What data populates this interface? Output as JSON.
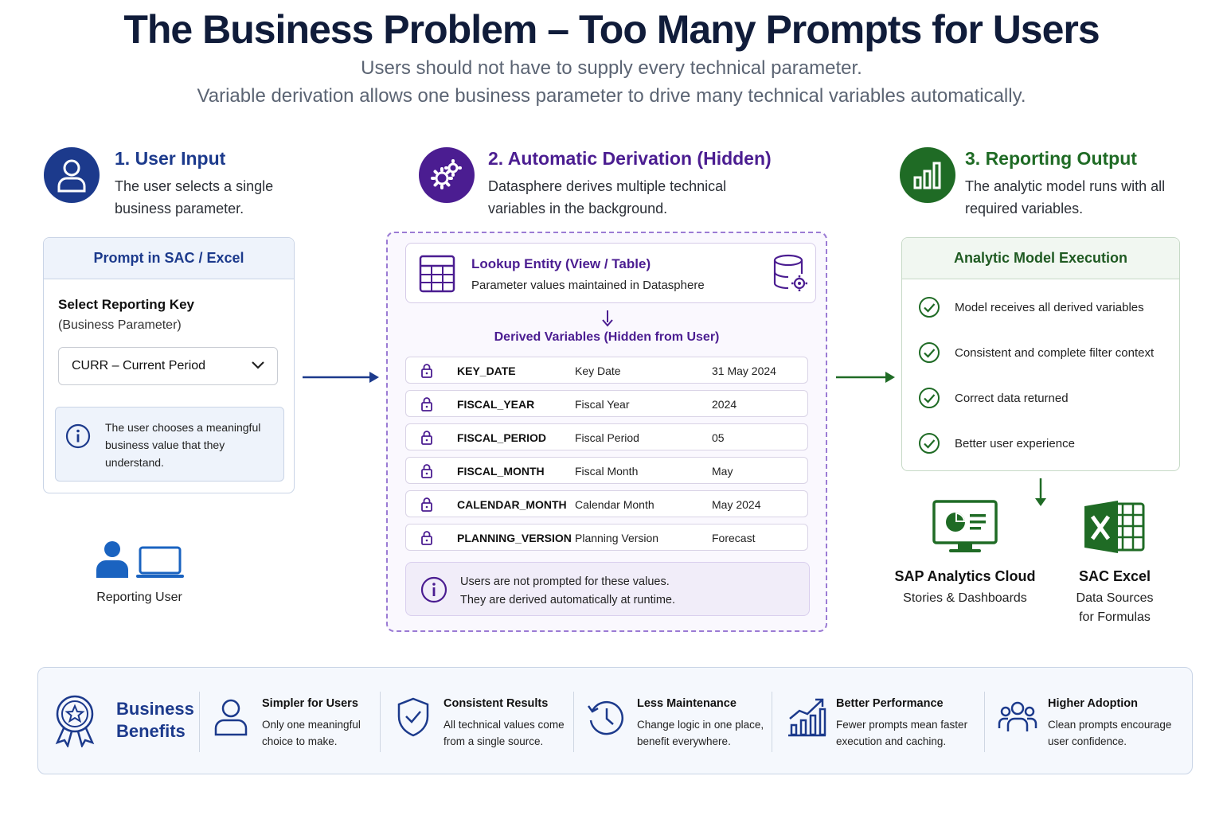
{
  "header": {
    "title": "The Business Problem – Too Many Prompts for Users",
    "subtitle_line1": "Users should not have to supply every technical parameter.",
    "subtitle_line2": "Variable derivation allows one business parameter to drive many technical variables automatically."
  },
  "colors": {
    "blue": "#1c3a8c",
    "purple": "#4b1d91",
    "green": "#1f6b25"
  },
  "steps": [
    {
      "title": "1. User Input",
      "desc_line1": "The user selects a single",
      "desc_line2": "business parameter.",
      "icon": "user-icon"
    },
    {
      "title": "2. Automatic Derivation (Hidden)",
      "desc_line1": "Datasphere derives multiple technical",
      "desc_line2": "variables in the background.",
      "icon": "gears-icon"
    },
    {
      "title": "3. Reporting Output",
      "desc_line1": "The analytic model runs with all",
      "desc_line2": "required variables.",
      "icon": "bar-chart-icon"
    }
  ],
  "prompt_card": {
    "header": "Prompt in SAC / Excel",
    "label": "Select Reporting Key",
    "sublabel": "(Business Parameter)",
    "selected_value": "CURR – Current Period",
    "info": "The user chooses a meaningful business value that they understand."
  },
  "reporting_user": {
    "label": "Reporting User"
  },
  "derivation": {
    "lookup_title": "Lookup Entity (View / Table)",
    "lookup_sub": "Parameter values maintained in Datasphere",
    "derived_header": "Derived Variables (Hidden from User)",
    "variables": [
      {
        "name": "KEY_DATE",
        "desc": "Key Date",
        "value": "31 May 2024"
      },
      {
        "name": "FISCAL_YEAR",
        "desc": "Fiscal Year",
        "value": "2024"
      },
      {
        "name": "FISCAL_PERIOD",
        "desc": "Fiscal Period",
        "value": "05"
      },
      {
        "name": "FISCAL_MONTH",
        "desc": "Fiscal Month",
        "value": "May"
      },
      {
        "name": "CALENDAR_MONTH",
        "desc": "Calendar Month",
        "value": "May 2024"
      },
      {
        "name": "PLANNING_VERSION",
        "desc": "Planning Version",
        "value": "Forecast"
      }
    ],
    "note_line1": "Users are not prompted for these values.",
    "note_line2": "They are derived automatically at runtime."
  },
  "execution": {
    "header": "Analytic Model Execution",
    "items": [
      "Model receives all derived variables",
      "Consistent and complete filter context",
      "Correct data returned",
      "Better user experience"
    ]
  },
  "tools": [
    {
      "name": "SAP Analytics Cloud",
      "sub1": "Stories & Dashboards",
      "sub2": ""
    },
    {
      "name": "SAC Excel",
      "sub1": "Data Sources",
      "sub2": "for Formulas"
    }
  ],
  "benefits": {
    "label_line1": "Business",
    "label_line2": "Benefits",
    "items": [
      {
        "title": "Simpler for Users",
        "desc1": "Only one meaningful",
        "desc2": "choice to make.",
        "icon": "user-icon"
      },
      {
        "title": "Consistent Results",
        "desc1": "All technical values come",
        "desc2": "from a single source.",
        "icon": "shield-check-icon"
      },
      {
        "title": "Less Maintenance",
        "desc1": "Change logic in one place,",
        "desc2": "benefit everywhere.",
        "icon": "clock-history-icon"
      },
      {
        "title": "Better Performance",
        "desc1": "Fewer prompts mean faster",
        "desc2": "execution and caching.",
        "icon": "growth-chart-icon"
      },
      {
        "title": "Higher Adoption",
        "desc1": "Clean prompts encourage",
        "desc2": "user confidence.",
        "icon": "group-icon"
      }
    ]
  }
}
